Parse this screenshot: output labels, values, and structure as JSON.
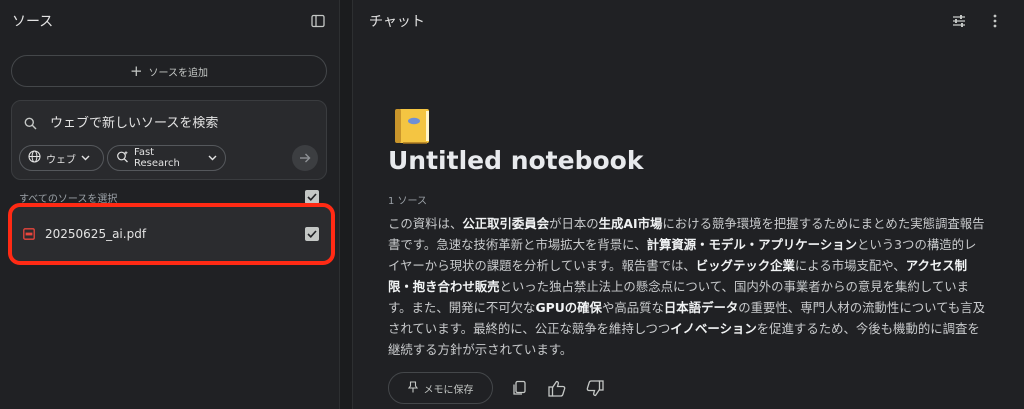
{
  "sources_panel": {
    "title": "ソース",
    "add_source_label": "ソースを追加",
    "search": {
      "placeholder": "ウェブで新しいソースを検索"
    },
    "chips": {
      "web": "ウェブ",
      "research": "Fast Research"
    },
    "select_all_label": "すべてのソースを選択",
    "items": [
      {
        "name": "20250625_ai.pdf",
        "checked": true
      }
    ]
  },
  "chat_panel": {
    "title": "チャット",
    "notebook_title": "Untitled notebook",
    "source_count": "1 ソース",
    "summary": [
      {
        "t": "この資料は、"
      },
      {
        "t": "公正取引委員会",
        "b": true
      },
      {
        "t": "が日本の"
      },
      {
        "t": "生成AI市場",
        "b": true
      },
      {
        "t": "における競争環境を把握するためにまとめた実態調査報告書です。急速な技術革新と市場拡大を背景に、"
      },
      {
        "t": "計算資源・モデル・アプリケーション",
        "b": true
      },
      {
        "t": "という3つの構造的レイヤーから現状の課題を分析しています。報告書では、"
      },
      {
        "t": "ビッグテック企業",
        "b": true
      },
      {
        "t": "による市場支配や、"
      },
      {
        "t": "アクセス制限・抱き合わせ販売",
        "b": true
      },
      {
        "t": "といった独占禁止法上の懸念点について、国内外の事業者からの意見を集約しています。また、開発に不可欠な"
      },
      {
        "t": "GPUの確保",
        "b": true
      },
      {
        "t": "や高品質な"
      },
      {
        "t": "日本語データ",
        "b": true
      },
      {
        "t": "の重要性、専門人材の流動性についても言及されています。最終的に、公正な競争を維持しつつ"
      },
      {
        "t": "イノベーション",
        "b": true
      },
      {
        "t": "を促進するため、今後も機動的に調査を継続する方針が示されています。"
      }
    ],
    "memo_button_label": "メモに保存"
  },
  "colors": {
    "panel_bg": "#202124",
    "page_bg": "#1b1c1e",
    "highlight": "#ff2a14",
    "pdf_red": "#e8453c"
  }
}
